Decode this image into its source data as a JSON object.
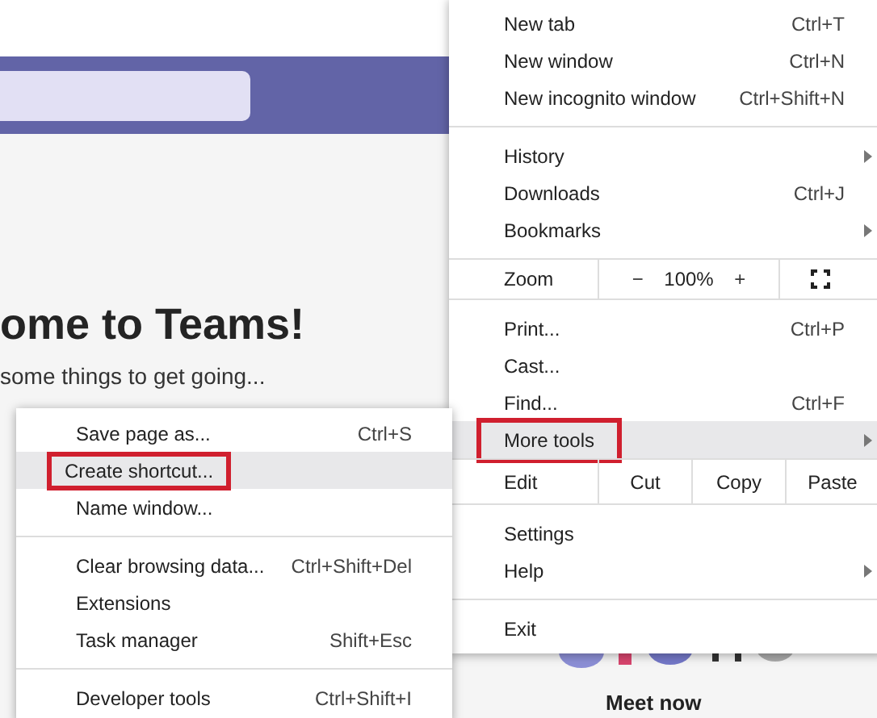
{
  "page": {
    "heading": "ome to Teams!",
    "subtitle": "some things to get going...",
    "footer_text": "Meet now"
  },
  "menu": {
    "items": [
      {
        "kind": "item",
        "label": "New tab",
        "shortcut": "Ctrl+T",
        "submenu": false,
        "selected": false,
        "outlined": false
      },
      {
        "kind": "item",
        "label": "New window",
        "shortcut": "Ctrl+N",
        "submenu": false,
        "selected": false,
        "outlined": false
      },
      {
        "kind": "item",
        "label": "New incognito window",
        "shortcut": "Ctrl+Shift+N",
        "submenu": false,
        "selected": false,
        "outlined": false
      },
      {
        "kind": "divider"
      },
      {
        "kind": "item",
        "label": "History",
        "submenu": true,
        "selected": false,
        "outlined": false
      },
      {
        "kind": "item",
        "label": "Downloads",
        "shortcut": "Ctrl+J",
        "submenu": false,
        "selected": false,
        "outlined": false
      },
      {
        "kind": "item",
        "label": "Bookmarks",
        "submenu": true,
        "selected": false,
        "outlined": false
      },
      {
        "kind": "divider"
      },
      {
        "kind": "zoom",
        "label": "Zoom",
        "minus": "−",
        "value": "100%",
        "plus": "+"
      },
      {
        "kind": "divider"
      },
      {
        "kind": "item",
        "label": "Print...",
        "shortcut": "Ctrl+P",
        "submenu": false,
        "selected": false,
        "outlined": false
      },
      {
        "kind": "item",
        "label": "Cast...",
        "submenu": false,
        "selected": false,
        "outlined": false
      },
      {
        "kind": "item",
        "label": "Find...",
        "shortcut": "Ctrl+F",
        "submenu": false,
        "selected": false,
        "outlined": false
      },
      {
        "kind": "item",
        "label": "More tools",
        "submenu": true,
        "selected": true,
        "outlined": true
      },
      {
        "kind": "edit",
        "label": "Edit",
        "buttons": [
          "Cut",
          "Copy",
          "Paste"
        ]
      },
      {
        "kind": "divider"
      },
      {
        "kind": "item",
        "label": "Settings",
        "submenu": false,
        "selected": false,
        "outlined": false
      },
      {
        "kind": "item",
        "label": "Help",
        "submenu": true,
        "selected": false,
        "outlined": false
      },
      {
        "kind": "divider"
      },
      {
        "kind": "item",
        "label": "Exit",
        "submenu": false,
        "selected": false,
        "outlined": false
      }
    ]
  },
  "submenu": {
    "items": [
      {
        "kind": "item",
        "label": "Save page as...",
        "shortcut": "Ctrl+S",
        "selected": false,
        "outlined": false
      },
      {
        "kind": "item",
        "label": "Create shortcut...",
        "selected": true,
        "outlined": true
      },
      {
        "kind": "item",
        "label": "Name window...",
        "selected": false,
        "outlined": false
      },
      {
        "kind": "divider"
      },
      {
        "kind": "item",
        "label": "Clear browsing data...",
        "shortcut": "Ctrl+Shift+Del",
        "selected": false,
        "outlined": false
      },
      {
        "kind": "item",
        "label": "Extensions",
        "selected": false,
        "outlined": false
      },
      {
        "kind": "item",
        "label": "Task manager",
        "shortcut": "Shift+Esc",
        "selected": false,
        "outlined": false
      },
      {
        "kind": "divider"
      },
      {
        "kind": "item",
        "label": "Developer tools",
        "shortcut": "Ctrl+Shift+I",
        "selected": false,
        "outlined": false
      }
    ]
  }
}
